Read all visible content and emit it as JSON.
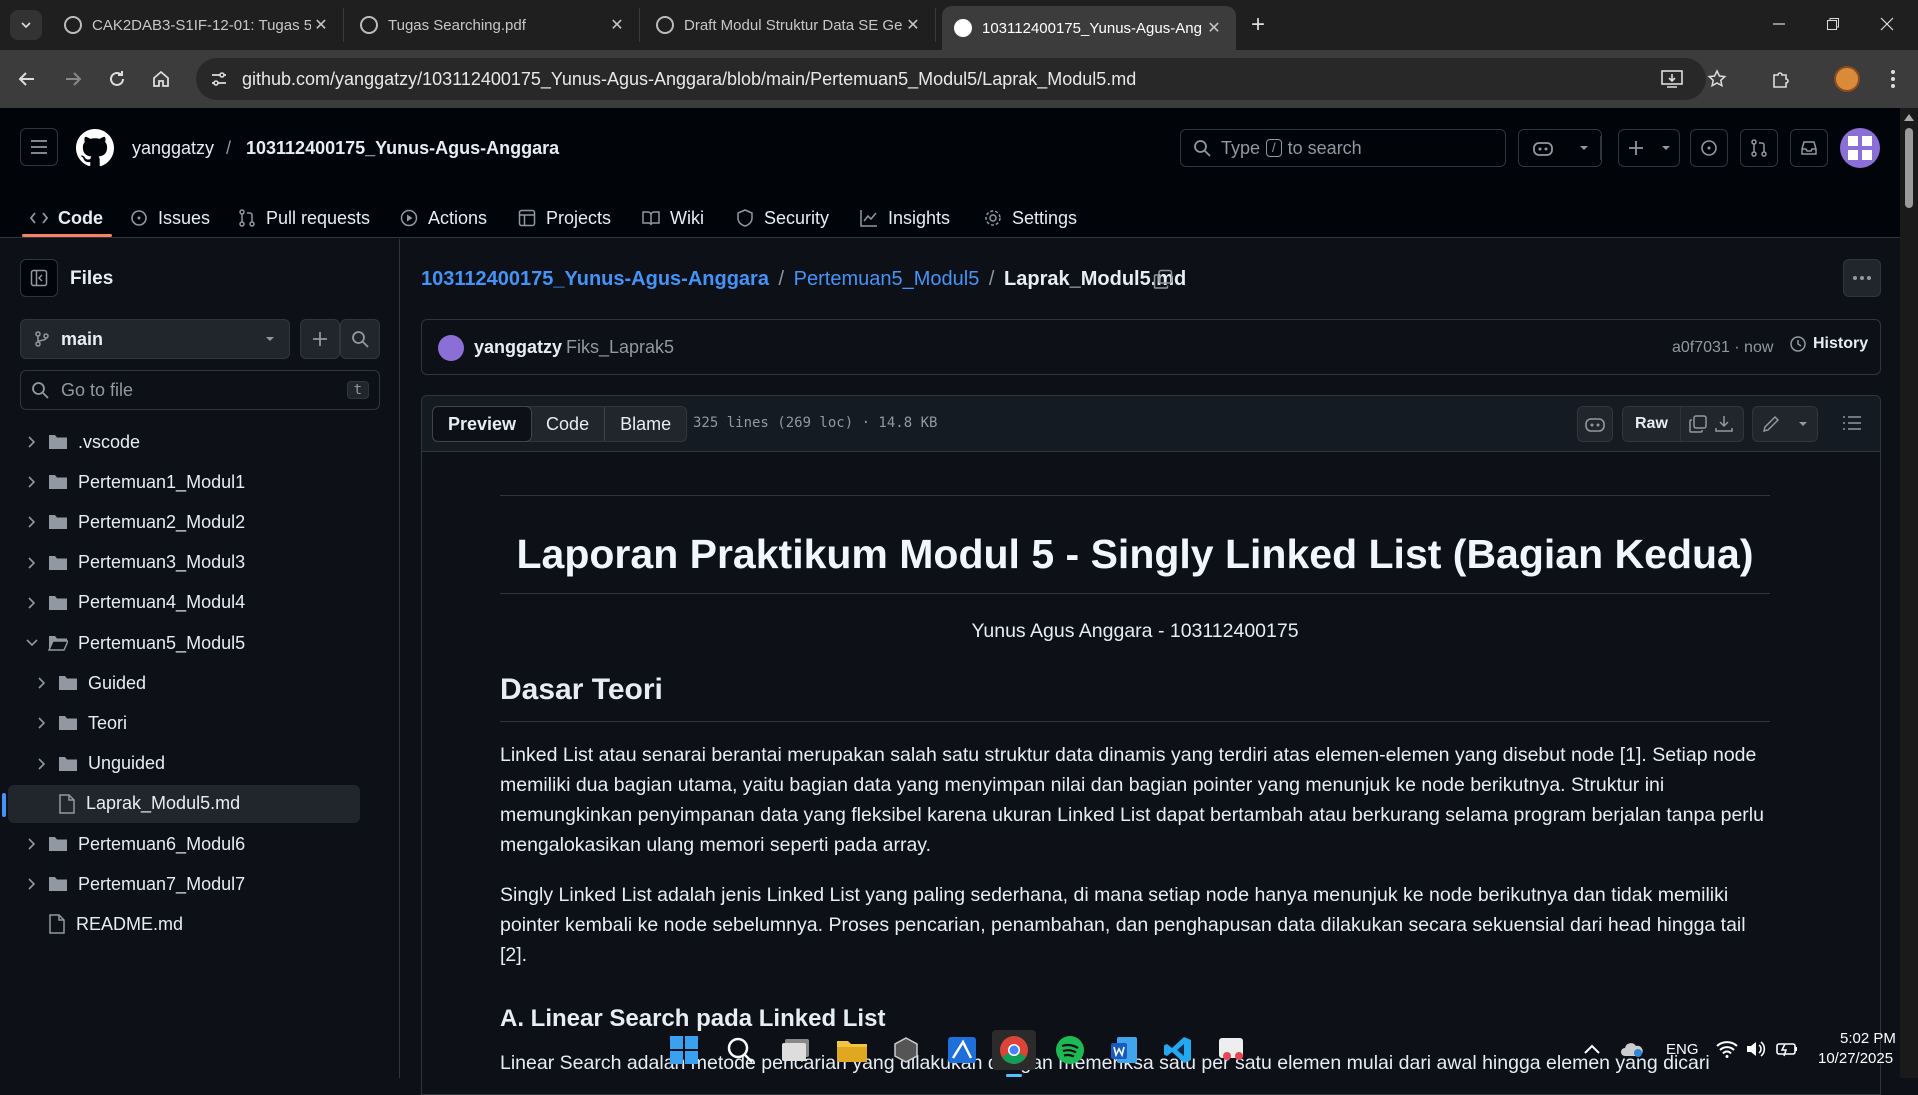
{
  "browser": {
    "tabs": [
      {
        "title": "CAK2DAB3-S1IF-12-01: Tugas 5",
        "active": false
      },
      {
        "title": "Tugas Searching.pdf",
        "active": false
      },
      {
        "title": "Draft Modul Struktur Data SE Ge",
        "active": false
      },
      {
        "title": "103112400175_Yunus-Agus-Ang",
        "active": true
      }
    ],
    "url": "github.com/yanggatzy/103112400175_Yunus-Agus-Anggara/blob/main/Pertemuan5_Modul5/Laprak_Modul5.md"
  },
  "header": {
    "owner": "yanggatzy",
    "separator": "/",
    "repo": "103112400175_Yunus-Agus-Anggara",
    "search_prefix": "Type",
    "search_key": "/",
    "search_suffix": "to search"
  },
  "nav": {
    "tabs": [
      {
        "label": "Code",
        "icon": "code-icon",
        "active": true
      },
      {
        "label": "Issues",
        "icon": "issue-icon"
      },
      {
        "label": "Pull requests",
        "icon": "pull-request-icon"
      },
      {
        "label": "Actions",
        "icon": "play-icon"
      },
      {
        "label": "Projects",
        "icon": "table-icon"
      },
      {
        "label": "Wiki",
        "icon": "book-icon"
      },
      {
        "label": "Security",
        "icon": "shield-icon"
      },
      {
        "label": "Insights",
        "icon": "graph-icon"
      },
      {
        "label": "Settings",
        "icon": "gear-icon"
      }
    ]
  },
  "sidebar": {
    "title": "Files",
    "branch": "main",
    "goto_placeholder": "Go to file",
    "goto_shortcut": "t",
    "tree": [
      {
        "name": ".vscode",
        "type": "folder",
        "depth": 0,
        "expanded": false
      },
      {
        "name": "Pertemuan1_Modul1",
        "type": "folder",
        "depth": 0,
        "expanded": false
      },
      {
        "name": "Pertemuan2_Modul2",
        "type": "folder",
        "depth": 0,
        "expanded": false
      },
      {
        "name": "Pertemuan3_Modul3",
        "type": "folder",
        "depth": 0,
        "expanded": false
      },
      {
        "name": "Pertemuan4_Modul4",
        "type": "folder",
        "depth": 0,
        "expanded": false
      },
      {
        "name": "Pertemuan5_Modul5",
        "type": "folder",
        "depth": 0,
        "expanded": true
      },
      {
        "name": "Guided",
        "type": "folder",
        "depth": 1,
        "expanded": false
      },
      {
        "name": "Teori",
        "type": "folder",
        "depth": 1,
        "expanded": false
      },
      {
        "name": "Unguided",
        "type": "folder",
        "depth": 1,
        "expanded": false
      },
      {
        "name": "Laprak_Modul5.md",
        "type": "file",
        "depth": 1,
        "selected": true
      },
      {
        "name": "Pertemuan6_Modul6",
        "type": "folder",
        "depth": 0,
        "expanded": false
      },
      {
        "name": "Pertemuan7_Modul7",
        "type": "folder",
        "depth": 0,
        "expanded": false
      },
      {
        "name": "README.md",
        "type": "file",
        "depth": 0
      }
    ]
  },
  "breadcrumb": {
    "repo": "103112400175_Yunus-Agus-Anggara",
    "folder": "Pertemuan5_Modul5",
    "file": "Laprak_Modul5.md",
    "sep": "/"
  },
  "commit": {
    "author": "yanggatzy",
    "message": "Fiks_Laprak5",
    "hash_time": "a0f7031 · now",
    "history_label": "History"
  },
  "file_toolbar": {
    "tabs": [
      "Preview",
      "Code",
      "Blame"
    ],
    "info": "325 lines (269 loc) · 14.8 KB",
    "raw_label": "Raw"
  },
  "document": {
    "title": "Laporan Praktikum Modul 5 - Singly Linked List (Bagian Kedua)",
    "author_line": "Yunus Agus Anggara - 103112400175",
    "h2": "Dasar Teori",
    "p1": "Linked List atau senarai berantai merupakan salah satu struktur data dinamis yang terdiri atas elemen-elemen yang disebut node [1]. Setiap node memiliki dua bagian utama, yaitu bagian data yang menyimpan nilai dan bagian pointer yang menunjuk ke node berikutnya. Struktur ini memungkinkan penyimpanan data yang fleksibel karena ukuran Linked List dapat bertambah atau berkurang selama program berjalan tanpa perlu mengalokasikan ulang memori seperti pada array.",
    "p2": "Singly Linked List adalah jenis Linked List yang paling sederhana, di mana setiap node hanya menunjuk ke node berikutnya dan tidak memiliki pointer kembali ke node sebelumnya. Proses pencarian, penambahan, dan penghapusan data dilakukan secara sekuensial dari head hingga tail [2].",
    "h3": "A. Linear Search pada Linked List",
    "p3": "Linear Search adalah metode pencarian yang dilakukan dengan memeriksa satu per satu elemen mulai dari awal hingga elemen yang dicari"
  },
  "taskbar": {
    "lang": "ENG",
    "time": "5:02 PM",
    "date": "10/27/2025"
  }
}
